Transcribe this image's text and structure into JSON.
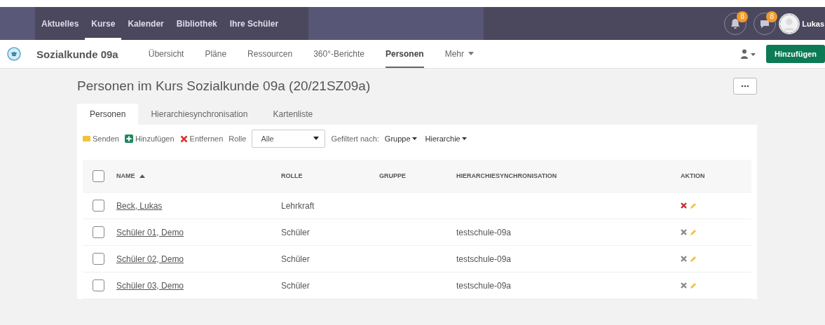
{
  "top_nav": [
    {
      "label": "Aktuelles",
      "selected": false
    },
    {
      "label": "Kurse",
      "selected": true
    },
    {
      "label": "Kalender",
      "selected": false
    },
    {
      "label": "Bibliothek",
      "selected": false
    },
    {
      "label": "Ihre Schüler",
      "selected": false
    }
  ],
  "notifications": {
    "count": "8"
  },
  "messages": {
    "count": "8"
  },
  "user": {
    "name": "Lukas"
  },
  "course": {
    "title": "Sozialkunde 09a"
  },
  "course_nav": [
    {
      "label": "Übersicht",
      "selected": false
    },
    {
      "label": "Pläne",
      "selected": false
    },
    {
      "label": "Ressourcen",
      "selected": false
    },
    {
      "label": "360°-Berichte",
      "selected": false
    },
    {
      "label": "Personen",
      "selected": true
    },
    {
      "label": "Mehr",
      "selected": false
    }
  ],
  "add_button": "Hinzufügen",
  "page_title": "Personen im Kurs Sozialkunde 09a (20/21SZ09a)",
  "tabs": [
    {
      "label": "Personen",
      "selected": true
    },
    {
      "label": "Hierarchiesynchronisation",
      "selected": false
    },
    {
      "label": "Kartenliste",
      "selected": false
    }
  ],
  "toolbar": {
    "send": "Senden",
    "add": "Hinzufügen",
    "remove": "Entfernen",
    "role_label": "Rolle",
    "role_value": "Alle",
    "filter_label": "Gefiltert nach:",
    "filters": [
      "Gruppe",
      "Hierarchie"
    ]
  },
  "table": {
    "select_all": {
      "checked": false
    },
    "columns": [
      "NAME",
      "ROLLE",
      "GRUPPE",
      "HIERARCHIESYNCHRONISATION",
      "AKTION"
    ],
    "rows": [
      {
        "name": "Beck, Lukas",
        "role": "Lehrkraft",
        "checked": false,
        "removable": true
      },
      {
        "name": "Schüler 01, Demo",
        "role": "Schüler",
        "sync": "testschule-09a",
        "checked": false,
        "removable": false
      },
      {
        "name": "Schüler 02, Demo",
        "role": "Schüler",
        "sync": "testschule-09a",
        "checked": false,
        "removable": false
      },
      {
        "name": "Schüler 03, Demo",
        "role": "Schüler",
        "sync": "testschule-09a",
        "checked": false,
        "removable": false
      }
    ]
  }
}
